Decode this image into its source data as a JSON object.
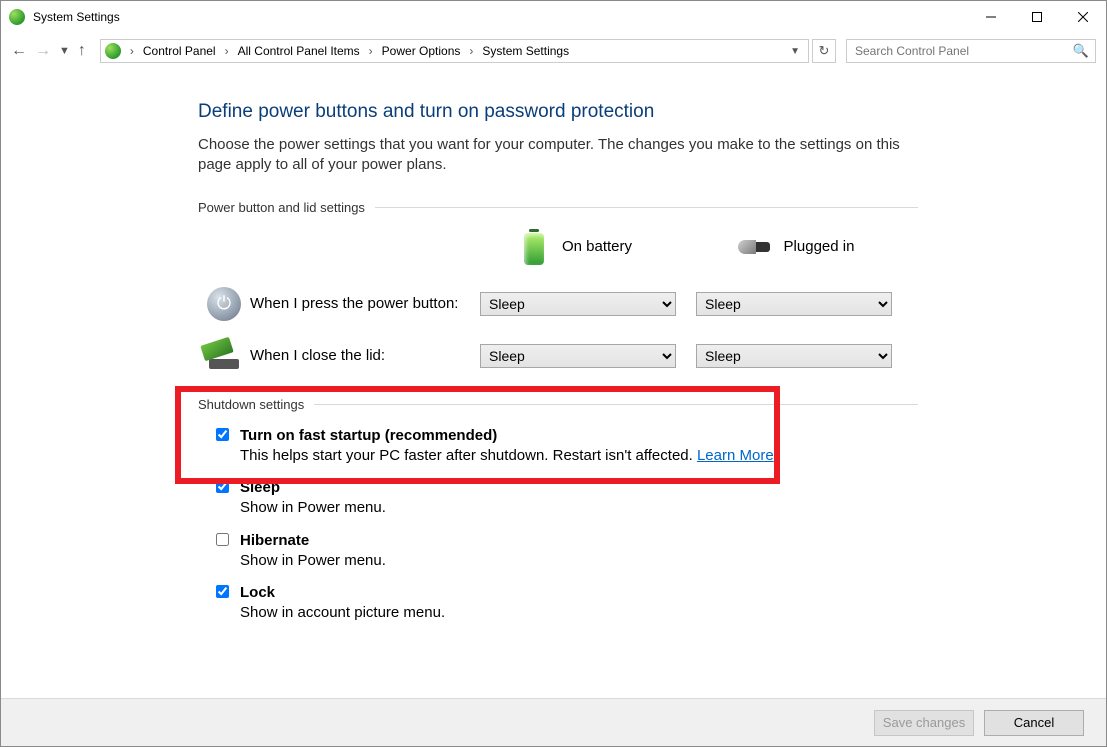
{
  "window": {
    "title": "System Settings"
  },
  "breadcrumb": {
    "items": [
      "Control Panel",
      "All Control Panel Items",
      "Power Options",
      "System Settings"
    ]
  },
  "search": {
    "placeholder": "Search Control Panel"
  },
  "page": {
    "title": "Define power buttons and turn on password protection",
    "description": "Choose the power settings that you want for your computer. The changes you make to the settings on this page apply to all of your power plans."
  },
  "sections": {
    "buttons_heading": "Power button and lid settings",
    "shutdown_heading": "Shutdown settings",
    "col_battery": "On battery",
    "col_plugged": "Plugged in",
    "row_power_label": "When I press the power button:",
    "row_lid_label": "When I close the lid:",
    "power_battery_value": "Sleep",
    "power_plugged_value": "Sleep",
    "lid_battery_value": "Sleep",
    "lid_plugged_value": "Sleep"
  },
  "shutdown": {
    "fast_startup": {
      "checked": true,
      "label": "Turn on fast startup (recommended)",
      "desc": "This helps start your PC faster after shutdown. Restart isn't affected. ",
      "link": "Learn More"
    },
    "sleep": {
      "checked": true,
      "label": "Sleep",
      "desc": "Show in Power menu."
    },
    "hibernate": {
      "checked": false,
      "label": "Hibernate",
      "desc": "Show in Power menu."
    },
    "lock": {
      "checked": true,
      "label": "Lock",
      "desc": "Show in account picture menu."
    }
  },
  "buttons": {
    "save": "Save changes",
    "cancel": "Cancel"
  }
}
